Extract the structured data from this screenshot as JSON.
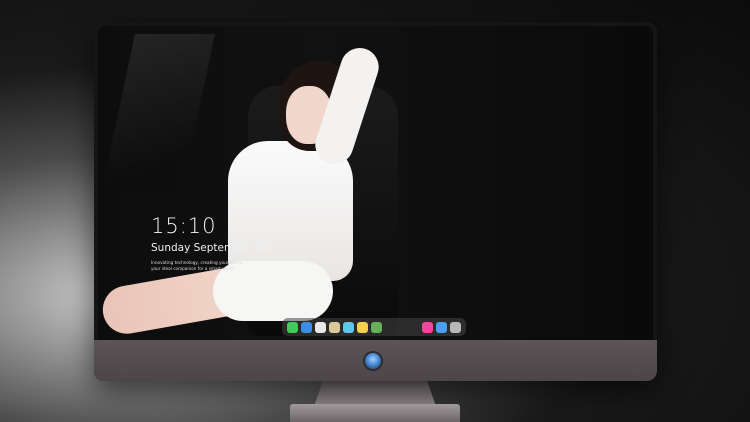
{
  "lock_screen": {
    "time": "15:10",
    "date": "Sunday September 15",
    "tagline_line1": "Innovating technology, creating your future",
    "tagline_line2": "your ideal companion for a smart world"
  },
  "dock": {
    "left_icons": [
      {
        "name": "messages-icon",
        "color": "#3ecb5a"
      },
      {
        "name": "finder-icon",
        "color": "#3a8ee8"
      },
      {
        "name": "safari-icon",
        "color": "#e8e8e8"
      },
      {
        "name": "preview-icon",
        "color": "#d8c89a"
      },
      {
        "name": "clapper-icon",
        "color": "#5ec6e6"
      },
      {
        "name": "notes-icon",
        "color": "#f6d04d"
      },
      {
        "name": "photos-icon",
        "color": "#66b05a"
      }
    ],
    "right_icons": [
      {
        "name": "music-icon",
        "color": "#f0479a"
      },
      {
        "name": "maps-icon",
        "color": "#4aa0f0"
      },
      {
        "name": "camera-icon",
        "color": "#b8b8b8"
      }
    ]
  },
  "brand": {
    "logo_icon": "assistant-logo-icon"
  }
}
